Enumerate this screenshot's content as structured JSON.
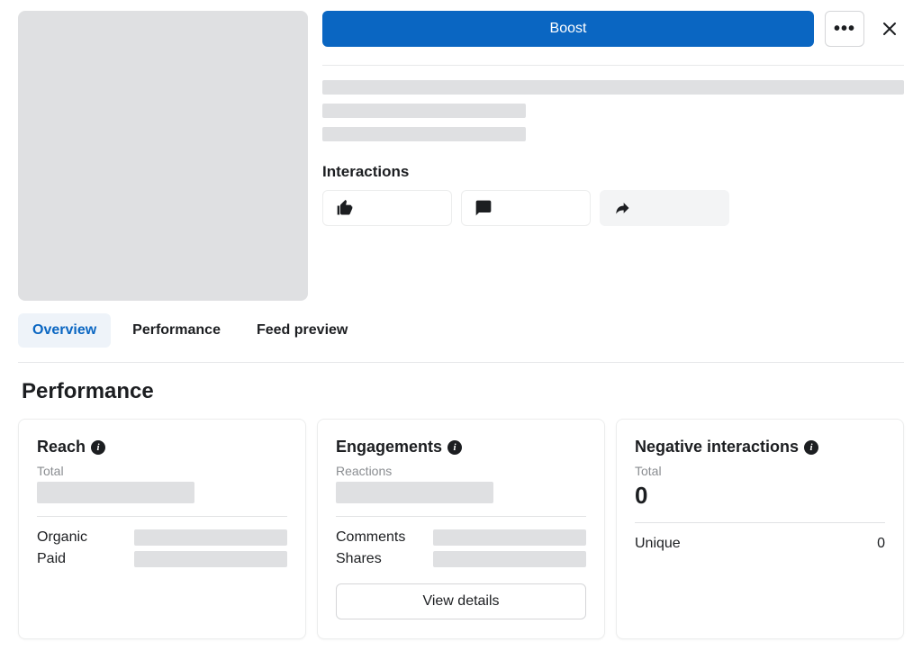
{
  "actions": {
    "boost_label": "Boost",
    "more_label": "•••"
  },
  "interactions": {
    "title": "Interactions",
    "like_icon": "thumbs-up",
    "comment_icon": "comment",
    "share_icon": "share"
  },
  "tabs": {
    "overview": "Overview",
    "performance": "Performance",
    "feed_preview": "Feed preview"
  },
  "section": {
    "heading": "Performance"
  },
  "cards": {
    "reach": {
      "title": "Reach",
      "total_label": "Total",
      "organic_label": "Organic",
      "paid_label": "Paid"
    },
    "engagements": {
      "title": "Engagements",
      "reactions_label": "Reactions",
      "comments_label": "Comments",
      "shares_label": "Shares",
      "view_details_label": "View details"
    },
    "negative": {
      "title": "Negative interactions",
      "total_label": "Total",
      "total_value": "0",
      "unique_label": "Unique",
      "unique_value": "0"
    }
  }
}
